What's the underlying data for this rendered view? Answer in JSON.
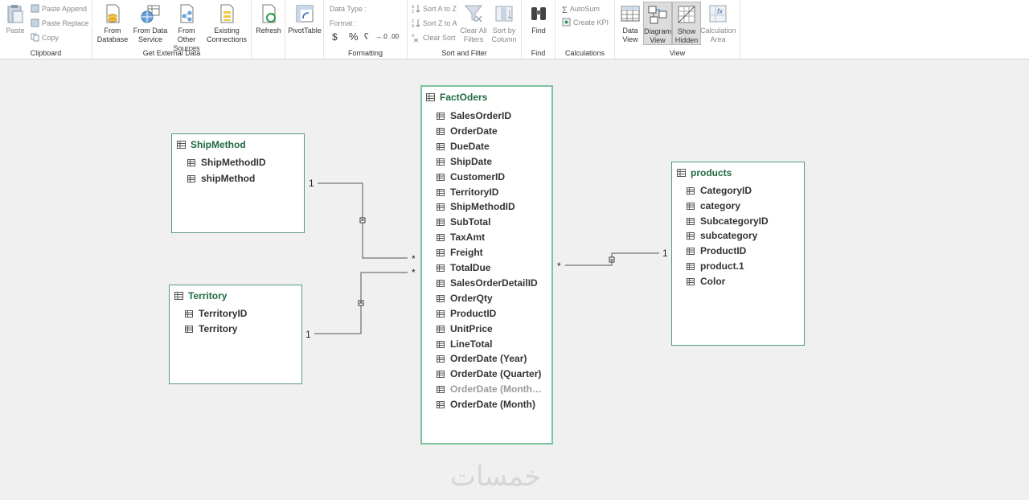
{
  "ribbon": {
    "clipboard": {
      "label": "Clipboard",
      "paste": "Paste",
      "paste_append": "Paste Append",
      "paste_replace": "Paste Replace",
      "copy": "Copy"
    },
    "external": {
      "label": "Get External Data",
      "from_database": "From Database",
      "from_data_service": "From Data Service",
      "from_other_sources": "From Other Sources",
      "existing_connections": "Existing Connections"
    },
    "refresh": "Refresh",
    "pivot": "PivotTable",
    "formatting": {
      "label": "Formatting",
      "data_type": "Data Type :",
      "format": "Format :",
      "currency": "$",
      "percent": "%",
      "comma": "ʕ",
      "inc": "→.0",
      "dec": ".00"
    },
    "sort": {
      "label": "Sort and Filter",
      "az": "Sort A to Z",
      "za": "Sort Z to A",
      "clear_sort": "Clear Sort",
      "clear_filters": "Clear All Filters",
      "sort_by_column": "Sort by Column"
    },
    "find": {
      "label": "Find",
      "btn": "Find"
    },
    "calc": {
      "label": "Calculations",
      "autosum": "AutoSum",
      "kpi": "Create KPI"
    },
    "view": {
      "label": "View",
      "data_view": "Data View",
      "diagram_view": "Diagram View",
      "show_hidden": "Show Hidden",
      "calc_area": "Calculation Area"
    }
  },
  "tables": {
    "shipmethod": {
      "name": "ShipMethod",
      "columns": [
        "ShipMethodID",
        "shipMethod"
      ]
    },
    "territory": {
      "name": "Territory",
      "columns": [
        "TerritoryID",
        "Territory"
      ]
    },
    "factoders": {
      "name": "FactOders",
      "columns": [
        "SalesOrderID",
        "OrderDate",
        "DueDate",
        "ShipDate",
        "CustomerID",
        "TerritoryID",
        "ShipMethodID",
        "SubTotal",
        "TaxAmt",
        "Freight",
        "TotalDue",
        "SalesOrderDetailID",
        "OrderQty",
        "ProductID",
        "UnitPrice",
        "LineTotal",
        "OrderDate (Year)",
        "OrderDate (Quarter)",
        "OrderDate (Month…",
        "OrderDate (Month)"
      ]
    },
    "products": {
      "name": "products",
      "columns": [
        "CategoryID",
        "category",
        "SubcategoryID",
        "subcategory",
        "ProductID",
        "product.1",
        "Color"
      ]
    }
  },
  "relations": {
    "one": "1",
    "many": "*"
  },
  "watermark": "خمسات",
  "colors": {
    "accent": "#1f6b3f",
    "table_border": "#5a9a7a",
    "selected_border": "#7cc4a0"
  }
}
